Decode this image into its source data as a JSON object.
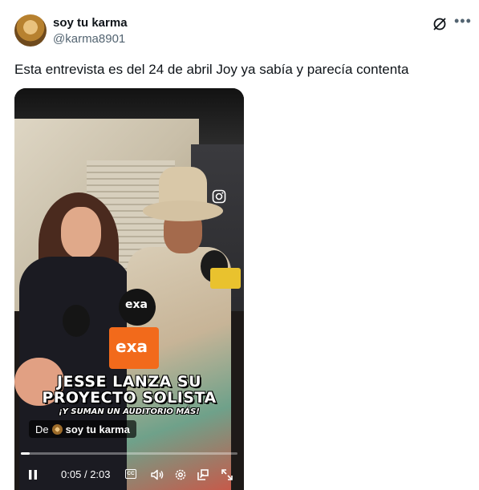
{
  "author": {
    "display_name": "soy tu karma",
    "handle": "@karma8901",
    "avatar_icon": "avatar-photo"
  },
  "header_actions": {
    "grok_icon": "grok-icon",
    "more_icon": "more-horizontal-icon"
  },
  "tweet": {
    "text": "Esta entrevista es del 24 de abril Joy ya sabía y parecía contenta"
  },
  "video": {
    "caption_main_line1": "JESSE LANZA SU",
    "caption_main_line2": "PROYECTO SOLISTA",
    "caption_sub": "¡Y SUMAN UN AUDITORIO MÁS!",
    "mic_logo_1": "exa",
    "mic_logo_2": "exa",
    "source_pill": {
      "prefix": "De",
      "who": "soy tu karma"
    },
    "progress_fraction": 0.04,
    "current_time": "0:05",
    "duration": "2:03",
    "time_separator": "/",
    "cc_label": "CC",
    "controls": [
      "pause-icon",
      "cc-icon",
      "volume-icon",
      "settings-icon",
      "pip-icon",
      "fullscreen-icon"
    ]
  },
  "colors": {
    "text_primary": "#0f1419",
    "text_secondary": "#536471",
    "exa_orange": "#f26a1b"
  }
}
